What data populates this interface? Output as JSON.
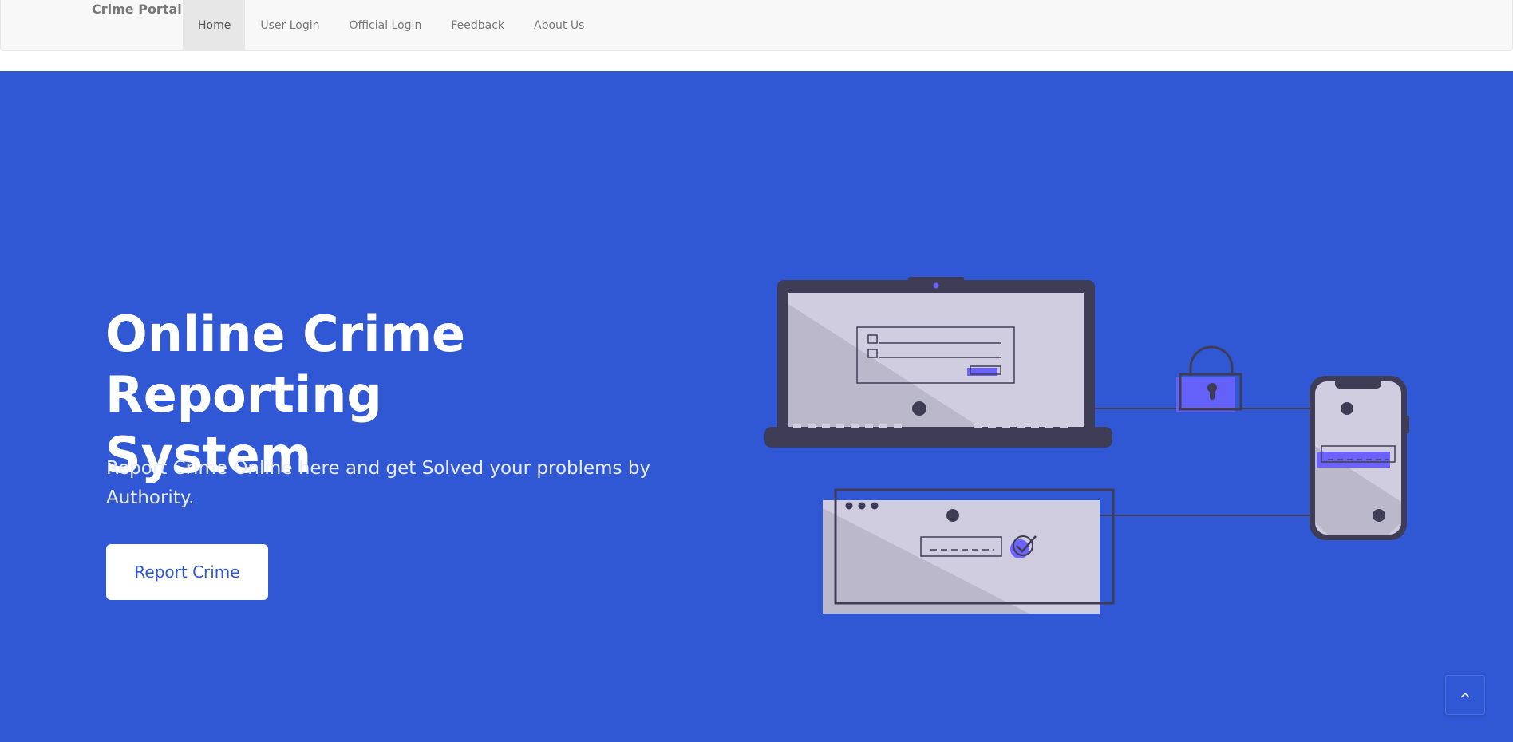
{
  "navbar": {
    "brand": "Crime Portal",
    "items": [
      {
        "label": "Home",
        "active": true
      },
      {
        "label": "User Login",
        "active": false
      },
      {
        "label": "Official Login",
        "active": false
      },
      {
        "label": "Feedback",
        "active": false
      },
      {
        "label": "About Us",
        "active": false
      }
    ]
  },
  "hero": {
    "title_line1": "Online Crime Reporting",
    "title_line2": "System",
    "subtitle": "Report Crime Online here and get Solved your problems by Authority.",
    "cta_label": "Report Crime"
  },
  "back_to_top": {
    "icon": "chevron-up-icon"
  },
  "colors": {
    "hero_bg": "#3058d5",
    "accent_purple": "#6c63ff",
    "device_dark": "#3f3d56",
    "screen_light": "#d0cde1",
    "nav_bg": "#f8f8f8"
  }
}
